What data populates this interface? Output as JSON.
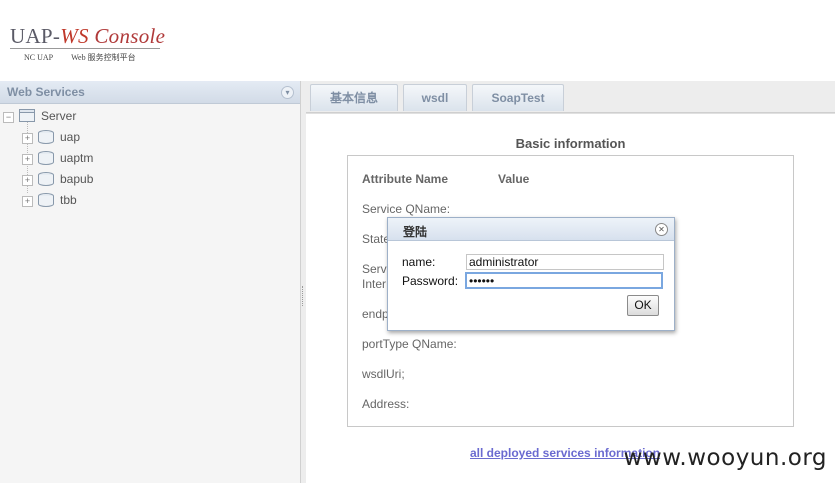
{
  "header": {
    "logo_prefix": "UAP-",
    "logo_ws": "WS",
    "logo_console": " Console",
    "logo_sub_left": "NC UAP",
    "logo_sub_right": "Web 服务控制平台"
  },
  "left_panel": {
    "title": "Web Services",
    "tree": {
      "root": "Server",
      "children": [
        "uap",
        "uaptm",
        "bapub",
        "tbb"
      ]
    }
  },
  "tabs": [
    "基本信息",
    "wsdl",
    "SoapTest"
  ],
  "basic_info": {
    "title": "Basic information",
    "col_attribute": "Attribute Name",
    "col_value": "Value",
    "rows": [
      "Service QName:",
      "State",
      "Serv",
      "Inter",
      "endp",
      "portType QName:",
      "wsdlUri;",
      "Address:"
    ]
  },
  "footer_link": "all deployed services information",
  "watermark": "www.wooyun.org",
  "dialog": {
    "title": "登陆",
    "name_label": "name:",
    "name_value": "administrator",
    "password_label": "Password:",
    "password_value": "••••••",
    "ok_label": "OK"
  },
  "colors": {
    "panel_header_text": "#7f8fa4",
    "link": "#6a6ad0",
    "focus_border": "#7aa7e0"
  }
}
